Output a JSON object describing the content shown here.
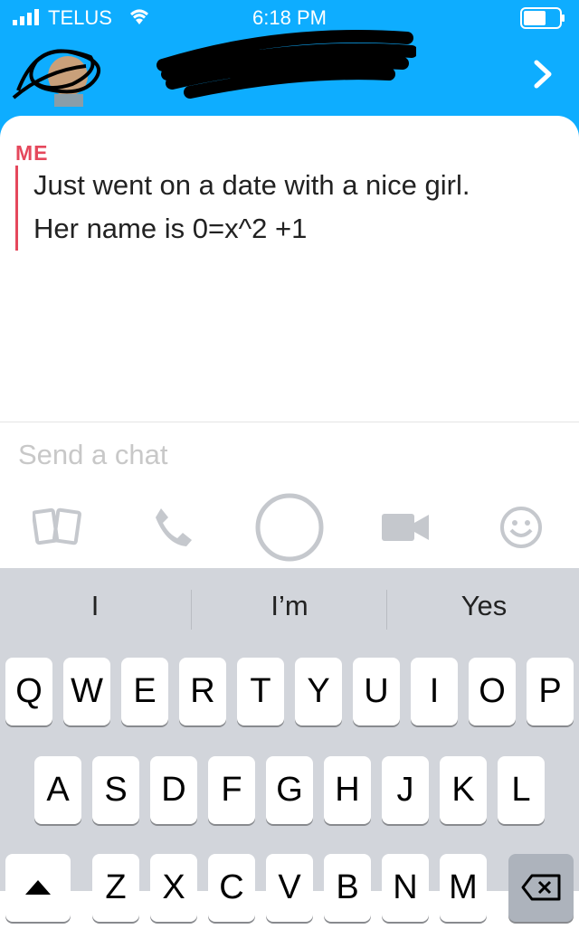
{
  "status": {
    "carrier": "TELUS",
    "time": "6:18 PM"
  },
  "chat": {
    "sender": "ME",
    "message_lines": [
      "Just went on a date with a nice girl.",
      "Her name is 0=x^2 +1"
    ]
  },
  "input": {
    "placeholder": "Send a chat"
  },
  "toolbar": [
    "gallery-icon",
    "phone-icon",
    "capture-button",
    "video-icon",
    "emoji-icon"
  ],
  "suggestions": [
    "I",
    "I’m",
    "Yes"
  ],
  "keyboard": {
    "row1": [
      "Q",
      "W",
      "E",
      "R",
      "T",
      "Y",
      "U",
      "I",
      "O",
      "P"
    ],
    "row2": [
      "A",
      "S",
      "D",
      "F",
      "G",
      "H",
      "J",
      "K",
      "L"
    ],
    "row3": [
      "Z",
      "X",
      "C",
      "V",
      "B",
      "N",
      "M"
    ]
  },
  "colors": {
    "header": "#0eadff",
    "me_label": "#e5485c",
    "keyboard_bg": "#d2d5db"
  }
}
